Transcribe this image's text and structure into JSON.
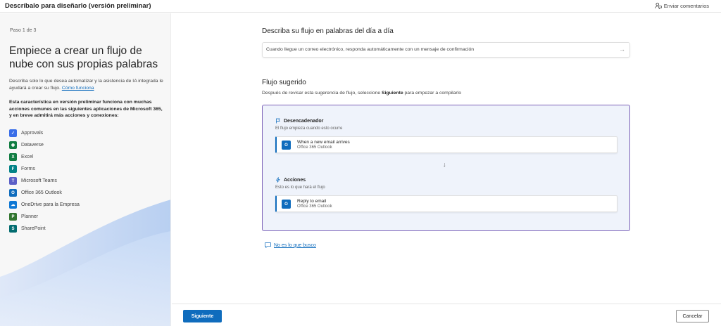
{
  "header": {
    "title": "Descríbalo para diseñarlo (versión preliminar)",
    "feedback_label": "Enviar comentarios",
    "feedback_icon": "person-feedback-icon"
  },
  "left": {
    "step": "Paso 1 de 3",
    "heading": "Empiece a crear un flujo de nube con sus propias palabras",
    "description": "Describa solo lo que desea automatizar y la asistencia de IA integrada le ayudará a crear su flujo.",
    "how_link": "Cómo funciona",
    "note": "Esta característica en versión preliminar funciona con muchas acciones comunes en las siguientes aplicaciones de Microsoft 365, y en breve admitirá más acciones y conexiones:",
    "apps": [
      {
        "label": "Approvals",
        "icon": "approvals-icon",
        "color": "#3a6ee8"
      },
      {
        "label": "Dataverse",
        "icon": "dataverse-icon",
        "color": "#107c41"
      },
      {
        "label": "Excel",
        "icon": "excel-icon",
        "color": "#107c41"
      },
      {
        "label": "Forms",
        "icon": "forms-icon",
        "color": "#038387"
      },
      {
        "label": "Microsoft Teams",
        "icon": "teams-icon",
        "color": "#5b5fc7"
      },
      {
        "label": "Office 365 Outlook",
        "icon": "outlook-icon",
        "color": "#0f6cbd"
      },
      {
        "label": "OneDrive para la Empresa",
        "icon": "onedrive-icon",
        "color": "#0f78d4"
      },
      {
        "label": "Planner",
        "icon": "planner-icon",
        "color": "#31752f"
      },
      {
        "label": "SharePoint",
        "icon": "sharepoint-icon",
        "color": "#036c70"
      }
    ]
  },
  "main": {
    "describe_heading": "Describa su flujo en palabras del día a día",
    "prompt_text": "Cuando llegue un correo electrónico, responda automáticamente con un mensaje de confirmación",
    "suggested_heading": "Flujo sugerido",
    "suggested_sub_pre": "Después de revisar esta sugerencia de flujo, seleccione ",
    "suggested_sub_bold": "Siguiente",
    "suggested_sub_post": " para empezar a compilarlo",
    "trigger": {
      "title": "Desencadenador",
      "subtitle": "El flujo empieza cuando esto ocurre",
      "card_title": "When a new email arrives",
      "card_sub": "Office 365 Outlook"
    },
    "actions": {
      "title": "Acciones",
      "subtitle": "Esto es lo que hará el flujo",
      "card_title": "Reply to email",
      "card_sub": "Office 365 Outlook"
    },
    "not_it_link": "No es lo que busco"
  },
  "footer": {
    "next_label": "Siguiente",
    "cancel_label": "Cancelar"
  }
}
